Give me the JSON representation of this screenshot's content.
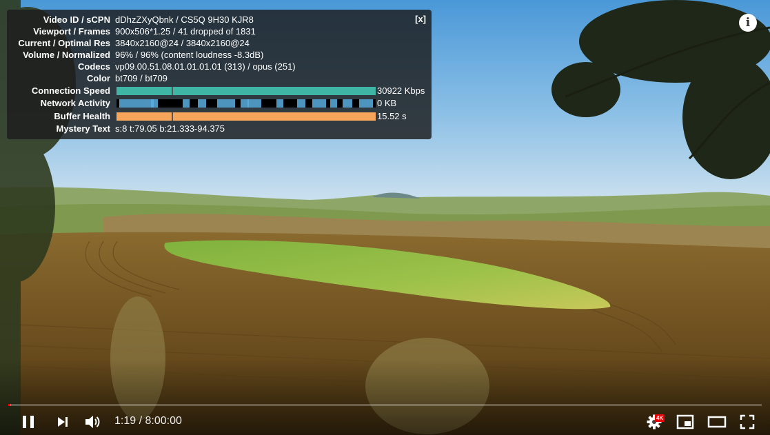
{
  "stats": {
    "close_label": "[x]",
    "rows": [
      {
        "label": "Video ID / sCPN",
        "value": "dDhzZXyQbnk / CS5Q 9H30 KJR8"
      },
      {
        "label": "Viewport / Frames",
        "value": "900x506*1.25 / 41 dropped of 1831"
      },
      {
        "label": "Current / Optimal Res",
        "value": "3840x2160@24 / 3840x2160@24"
      },
      {
        "label": "Volume / Normalized",
        "value": "96% / 96% (content loudness -8.3dB)"
      },
      {
        "label": "Codecs",
        "value": "vp09.00.51.08.01.01.01.01 (313) / opus (251)"
      },
      {
        "label": "Color",
        "value": "bt709 / bt709"
      }
    ],
    "connection_speed": {
      "label": "Connection Speed",
      "value": "30922 Kbps",
      "color": "#3fb5a5"
    },
    "network_activity": {
      "label": "Network Activity",
      "value": "0 KB",
      "color": "#5aaee0"
    },
    "buffer_health": {
      "label": "Buffer Health",
      "value": "15.52 s",
      "color": "#f7a55a"
    },
    "mystery_text": {
      "label": "Mystery Text",
      "value": "s:8 t:79.05 b:21.333-94.375"
    }
  },
  "controls": {
    "time": "1:19 / 8:00:00",
    "progress_fraction": 0.0027,
    "buffered_fraction": 0.0033,
    "quality_badge": "4K",
    "accent": "#ff0000"
  },
  "icons": {
    "info": "i"
  }
}
